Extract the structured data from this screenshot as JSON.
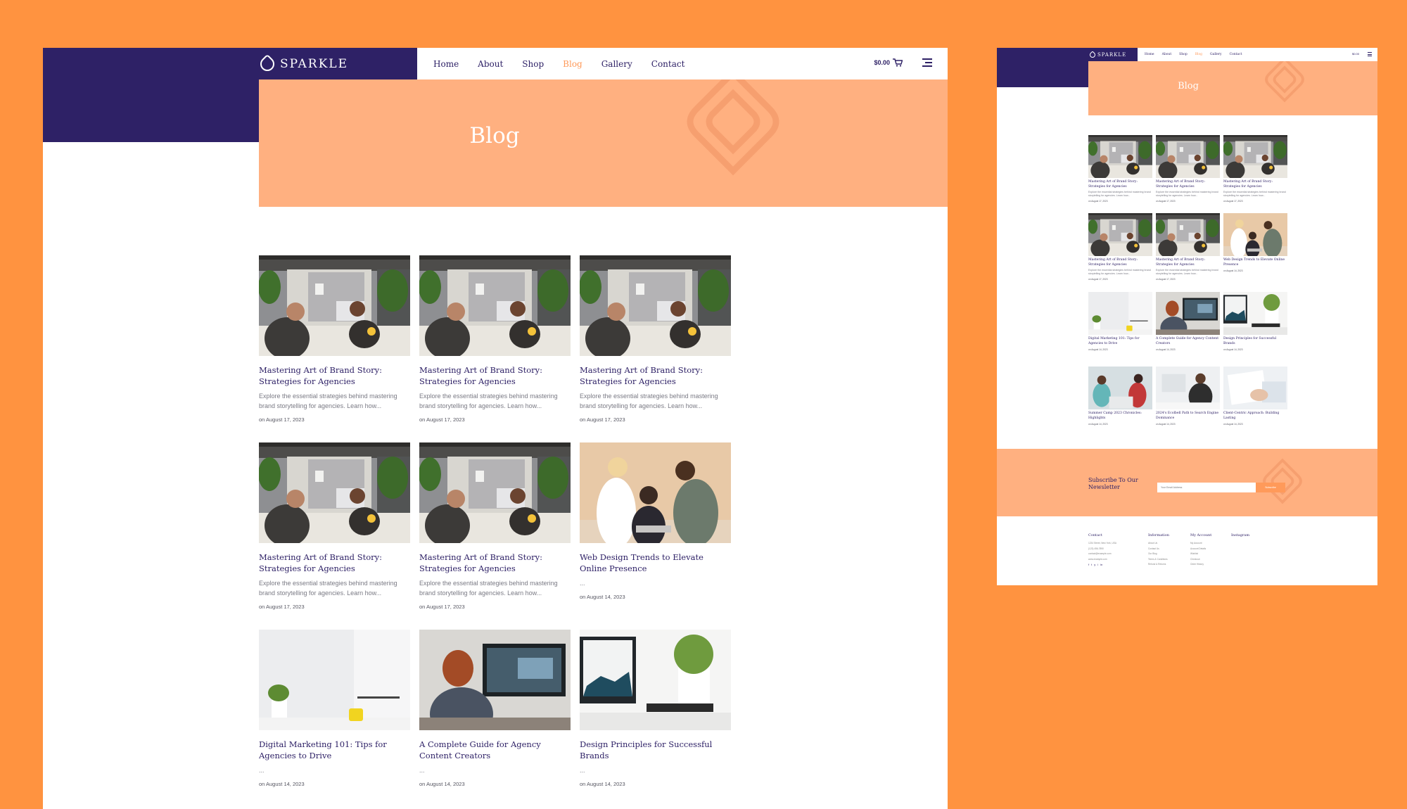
{
  "brand": {
    "name": "SPARKLE"
  },
  "nav": {
    "items": [
      {
        "label": "Home",
        "active": false
      },
      {
        "label": "About",
        "active": false
      },
      {
        "label": "Shop",
        "active": false
      },
      {
        "label": "Blog",
        "active": true
      },
      {
        "label": "Gallery",
        "active": false
      },
      {
        "label": "Contact",
        "active": false
      }
    ],
    "cart_total": "$0.00"
  },
  "hero": {
    "title": "Blog"
  },
  "posts": [
    {
      "title": "Mastering Art of Brand Story: Strategies for Agencies",
      "excerpt": "Explore the essential strategies behind mastering brand storytelling for agencies. Learn how...",
      "date": "on August 17, 2023",
      "image": "office"
    },
    {
      "title": "Mastering Art of Brand Story: Strategies for Agencies",
      "excerpt": "Explore the essential strategies behind mastering brand storytelling for agencies. Learn how...",
      "date": "on August 17, 2023",
      "image": "office"
    },
    {
      "title": "Mastering Art of Brand Story: Strategies for Agencies",
      "excerpt": "Explore the essential strategies behind mastering brand storytelling for agencies. Learn how...",
      "date": "on August 17, 2023",
      "image": "office"
    },
    {
      "title": "Mastering Art of Brand Story: Strategies for Agencies",
      "excerpt": "Explore the essential strategies behind mastering brand storytelling for agencies. Learn how...",
      "date": "on August 17, 2023",
      "image": "office"
    },
    {
      "title": "Mastering Art of Brand Story: Strategies for Agencies",
      "excerpt": "Explore the essential strategies behind mastering brand storytelling for agencies. Learn how...",
      "date": "on August 17, 2023",
      "image": "office"
    },
    {
      "title": "Web Design Trends to Elevate Online Presence",
      "excerpt": "...",
      "date": "on August 14, 2023",
      "image": "team"
    },
    {
      "title": "Digital Marketing 101: Tips for Agencies to Drive",
      "excerpt": "...",
      "date": "on August 14, 2023",
      "image": "desk"
    },
    {
      "title": "A Complete Guide for Agency Content Creators",
      "excerpt": "...",
      "date": "on August 14, 2023",
      "image": "monitor"
    },
    {
      "title": "Design Principles for Successful Brands",
      "excerpt": "...",
      "date": "on August 14, 2023",
      "image": "laptop"
    }
  ],
  "mini_posts": [
    {
      "title": "Mastering Art of Brand Story: Strategies for Agencies",
      "excerpt": "Explore the essential strategies behind mastering brand storytelling for agencies. Learn how...",
      "date": "on August 17, 2023",
      "image": "office"
    },
    {
      "title": "Mastering Art of Brand Story: Strategies for Agencies",
      "excerpt": "Explore the essential strategies behind mastering brand storytelling for agencies. Learn how...",
      "date": "on August 17, 2023",
      "image": "office"
    },
    {
      "title": "Mastering Art of Brand Story: Strategies for Agencies",
      "excerpt": "Explore the essential strategies behind mastering brand storytelling for agencies. Learn how...",
      "date": "on August 17, 2023",
      "image": "office"
    },
    {
      "title": "Mastering Art of Brand Story: Strategies for Agencies",
      "excerpt": "Explore the essential strategies behind mastering brand storytelling for agencies. Learn how...",
      "date": "on August 17, 2023",
      "image": "office"
    },
    {
      "title": "Mastering Art of Brand Story: Strategies for Agencies",
      "excerpt": "Explore the essential strategies behind mastering brand storytelling for agencies. Learn how...",
      "date": "on August 17, 2023",
      "image": "office"
    },
    {
      "title": "Web Design Trends to Elevate Online Presence",
      "excerpt": "",
      "date": "on August 14, 2023",
      "image": "team"
    },
    {
      "title": "Digital Marketing 101: Tips for Agencies to Drive",
      "excerpt": "",
      "date": "on August 14, 2023",
      "image": "desk"
    },
    {
      "title": "A Complete Guide for Agency Content Creators",
      "excerpt": "",
      "date": "on August 14, 2023",
      "image": "monitor"
    },
    {
      "title": "Design Principles for Successful Brands",
      "excerpt": "",
      "date": "on August 14, 2023",
      "image": "laptop"
    },
    {
      "title": "Summer Camp 2023 Chronicles: Highlights",
      "excerpt": "",
      "date": "on August 14, 2023",
      "image": "meeting"
    },
    {
      "title": "2024's Ecolbell Path to Search Engine Dominance",
      "excerpt": "",
      "date": "on August 14, 2023",
      "image": "monitor2"
    },
    {
      "title": "Client-Centric Approach: Building Lasting",
      "excerpt": "",
      "date": "on August 14, 2023",
      "image": "papers"
    }
  ],
  "newsletter": {
    "title": "Subscribe To Our Newsletter",
    "placeholder": "Your Email Address",
    "button": "Subscribe"
  },
  "footer": {
    "columns": [
      {
        "title": "Contact",
        "items": [
          "1234 Street, New York, USA",
          "(123) 456-7890",
          "contact@example.com",
          "www.example.com"
        ]
      },
      {
        "title": "Information",
        "items": [
          "About Us",
          "Contact Us",
          "Our Blog",
          "Terms & Conditions",
          "Refund & Returns"
        ]
      },
      {
        "title": "My Account",
        "items": [
          "My Account",
          "Account Details",
          "Wishlist",
          "Checkout",
          "Order History"
        ]
      },
      {
        "title": "Instagram",
        "items": []
      }
    ],
    "socials": [
      "f",
      "t",
      "y",
      "i",
      "in"
    ]
  },
  "colors": {
    "background": "#ff9340",
    "brand_purple": "#2e2166",
    "hero_peach": "#ffb080",
    "accent": "#ff9a5a"
  }
}
